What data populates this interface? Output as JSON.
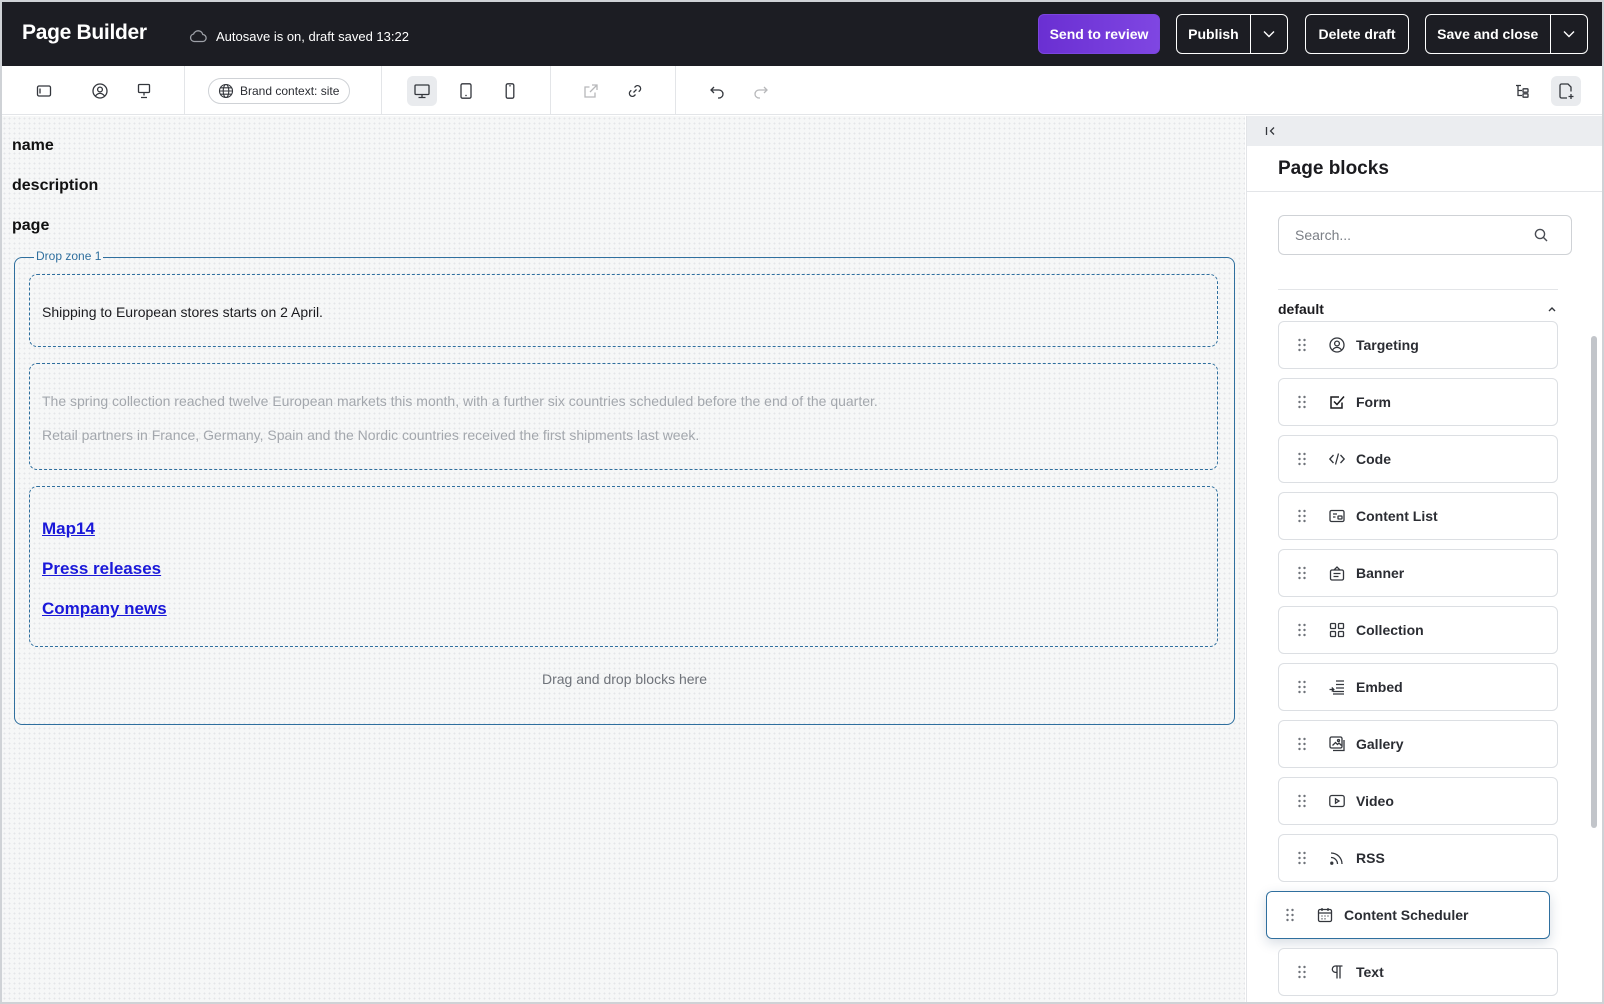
{
  "header": {
    "app_title": "Page Builder",
    "autosave_text": "Autosave is on, draft saved 13:22",
    "send_review_label": "Send to review",
    "publish_label": "Publish",
    "delete_draft_label": "Delete draft",
    "save_close_label": "Save and close",
    "accent_color": "#7b45de"
  },
  "toolbar": {
    "brand_context_label": "Brand context: site",
    "active_device": "desktop"
  },
  "canvas": {
    "field_labels": [
      "name",
      "description",
      "page"
    ],
    "drop_zone_label": "Drop zone 1",
    "blocks": [
      {
        "text": "Shipping to European stores starts on 2 April."
      },
      {
        "lines": [
          "The spring collection reached twelve European markets this month, with a further six countries scheduled before the end of the quarter.",
          "Retail partners in France, Germany, Spain and the Nordic countries received the first shipments last week."
        ]
      },
      {
        "links": [
          "Map14",
          "Press releases",
          "Company news"
        ]
      }
    ],
    "drop_hint": "Drag and drop blocks here"
  },
  "panel": {
    "title": "Page blocks",
    "search_placeholder": "Search...",
    "group_title": "default",
    "items": [
      {
        "label": "Targeting",
        "icon": "user-circle-icon"
      },
      {
        "label": "Form",
        "icon": "checkbox-icon"
      },
      {
        "label": "Code",
        "icon": "code-icon"
      },
      {
        "label": "Content List",
        "icon": "content-list-icon"
      },
      {
        "label": "Banner",
        "icon": "banner-icon"
      },
      {
        "label": "Collection",
        "icon": "grid-icon"
      },
      {
        "label": "Embed",
        "icon": "embed-icon"
      },
      {
        "label": "Gallery",
        "icon": "gallery-icon"
      },
      {
        "label": "Video",
        "icon": "video-icon"
      },
      {
        "label": "RSS",
        "icon": "rss-icon"
      },
      {
        "label": "Content Scheduler",
        "icon": "calendar-icon"
      },
      {
        "label": "Text",
        "icon": "paragraph-icon"
      }
    ]
  }
}
